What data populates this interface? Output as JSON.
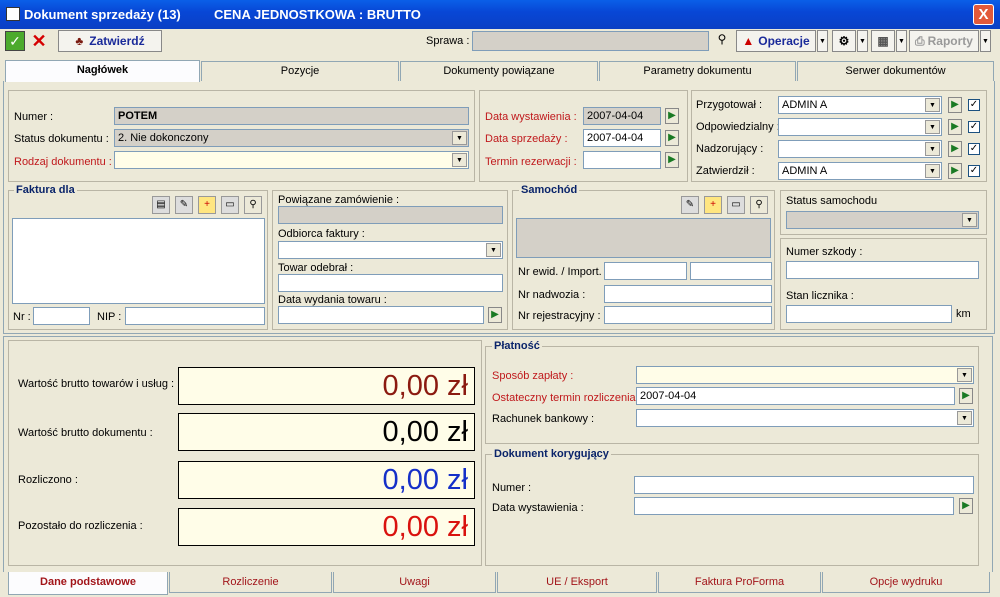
{
  "window": {
    "title": "Dokument sprzedaży (13)",
    "subtitle": "CENA JEDNOSTKOWA : BRUTTO",
    "close": "X"
  },
  "toolbar": {
    "confirm": "Zatwierdź",
    "sprawa_label": "Sprawa :",
    "operacje": "Operacje",
    "raporty": "Raporty"
  },
  "tabs": [
    "Nagłówek",
    "Pozycje",
    "Dokumenty powiązane",
    "Parametry dokumentu",
    "Serwer dokumentów"
  ],
  "header": {
    "numer_label": "Numer :",
    "numer_value": "POTEM",
    "status_label": "Status dokumentu :",
    "status_value": "2. Nie dokonczony",
    "rodzaj_label": "Rodzaj dokumentu :",
    "rodzaj_value": ""
  },
  "dates": {
    "wyst_label": "Data wystawienia :",
    "wyst_value": "2007-04-04",
    "sprz_label": "Data sprzedaży :",
    "sprz_value": "2007-04-04",
    "rez_label": "Termin rezerwacji :",
    "rez_value": ""
  },
  "people": [
    {
      "label": "Przygotował :",
      "value": "ADMIN A"
    },
    {
      "label": "Odpowiedzialny :",
      "value": ""
    },
    {
      "label": "Nadzorujący :",
      "value": ""
    },
    {
      "label": "Zatwierdził :",
      "value": "ADMIN A"
    }
  ],
  "faktura": {
    "title": "Faktura dla",
    "nr_label": "Nr :",
    "nip_label": "NIP :"
  },
  "mid": {
    "zam_label": "Powiązane zamówienie :",
    "odb_label": "Odbiorca faktury :",
    "towar_label": "Towar odebrał :",
    "data_label": "Data wydania towaru :"
  },
  "samochod": {
    "title": "Samochód",
    "ewid_label": "Nr ewid. / Import.",
    "nadw_label": "Nr nadwozia :",
    "rej_label": "Nr rejestracyjny :"
  },
  "status_sam": {
    "label": "Status samochodu",
    "szkoda_label": "Numer szkody :",
    "licznik_label": "Stan licznika :",
    "km": "km"
  },
  "values": [
    {
      "label": "Wartość brutto towarów i usług :",
      "amount": "0,00 zł",
      "color": "#8b1a10"
    },
    {
      "label": "Wartość brutto dokumentu :",
      "amount": "0,00 zł",
      "color": "#000000"
    },
    {
      "label": "Rozliczono :",
      "amount": "0,00 zł",
      "color": "#1530c8"
    },
    {
      "label": "Pozostało do rozliczenia :",
      "amount": "0,00 zł",
      "color": "#d9120e"
    }
  ],
  "platnosc": {
    "title": "Płatność",
    "sposob_label": "Sposób zapłaty :",
    "termin_label": "Ostateczny termin rozliczenia :",
    "termin_value": "2007-04-04",
    "rachunek_label": "Rachunek bankowy :"
  },
  "koryg": {
    "title": "Dokument korygujący",
    "numer_label": "Numer :",
    "data_label": "Data wystawienia :"
  },
  "bottom_tabs": [
    "Dane podstawowe",
    "Rozliczenie",
    "Uwagi",
    "UE / Eksport",
    "Faktura ProForma",
    "Opcje wydruku"
  ]
}
